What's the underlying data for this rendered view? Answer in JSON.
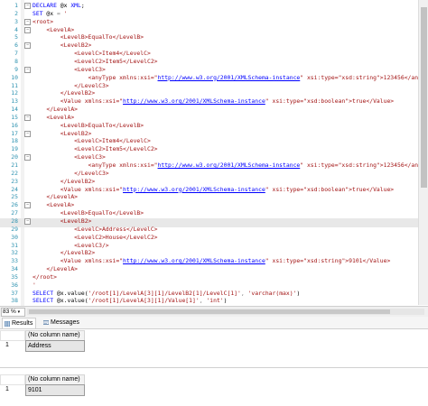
{
  "editor": {
    "lines": [
      {
        "n": "1",
        "c": [
          [
            "k",
            "DECLARE "
          ],
          [
            "p",
            "@x "
          ],
          [
            "k",
            "XML"
          ],
          [
            "p",
            ";"
          ]
        ]
      },
      {
        "n": "2",
        "c": [
          [
            "k",
            "SET "
          ],
          [
            "p",
            "@x "
          ],
          [
            "g",
            "= "
          ],
          [
            "str",
            "'"
          ]
        ]
      },
      {
        "n": "3",
        "c": [
          [
            "tag",
            "<root>"
          ]
        ]
      },
      {
        "n": "4",
        "c": [
          [
            "tag",
            "    <LevelA>"
          ]
        ]
      },
      {
        "n": "5",
        "c": [
          [
            "tag",
            "        <LevelB>EqualTo</LevelB>"
          ]
        ]
      },
      {
        "n": "6",
        "c": [
          [
            "tag",
            "        <LevelB2>"
          ]
        ]
      },
      {
        "n": "7",
        "c": [
          [
            "tag",
            "            <LevelC>Item4</LevelC>"
          ]
        ]
      },
      {
        "n": "8",
        "c": [
          [
            "tag",
            "            <LevelC2>Item5</LevelC2>"
          ]
        ]
      },
      {
        "n": "9",
        "c": [
          [
            "tag",
            "            <LevelC3>"
          ]
        ]
      },
      {
        "n": "10",
        "c": [
          [
            "tag",
            "                <anyType xmlns:xsi=\""
          ],
          [
            "url",
            "http://www.w3.org/2001/XMLSchema-instance"
          ],
          [
            "tag",
            "\" xsi:type=\"xsd:string\">123456</anyType>"
          ]
        ]
      },
      {
        "n": "11",
        "c": [
          [
            "tag",
            "            </LevelC3>"
          ]
        ]
      },
      {
        "n": "12",
        "c": [
          [
            "tag",
            "        </LevelB2>"
          ]
        ]
      },
      {
        "n": "13",
        "c": [
          [
            "tag",
            "        <Value xmlns:xsi=\""
          ],
          [
            "url",
            "http://www.w3.org/2001/XMLSchema-instance"
          ],
          [
            "tag",
            "\" xsi:type=\"xsd:boolean\">true</Value>"
          ]
        ]
      },
      {
        "n": "14",
        "c": [
          [
            "tag",
            "    </LevelA>"
          ]
        ]
      },
      {
        "n": "15",
        "c": [
          [
            "tag",
            "    <LevelA>"
          ]
        ]
      },
      {
        "n": "16",
        "c": [
          [
            "tag",
            "        <LevelB>EqualTo</LevelB>"
          ]
        ]
      },
      {
        "n": "17",
        "c": [
          [
            "tag",
            "        <LevelB2>"
          ]
        ]
      },
      {
        "n": "18",
        "c": [
          [
            "tag",
            "            <LevelC>Item4</LevelC>"
          ]
        ]
      },
      {
        "n": "19",
        "c": [
          [
            "tag",
            "            <LevelC2>Item5</LevelC2>"
          ]
        ]
      },
      {
        "n": "20",
        "c": [
          [
            "tag",
            "            <LevelC3>"
          ]
        ]
      },
      {
        "n": "21",
        "c": [
          [
            "tag",
            "                <anyType xmlns:xsi=\""
          ],
          [
            "url",
            "http://www.w3.org/2001/XMLSchema-instance"
          ],
          [
            "tag",
            "\" xsi:type=\"xsd:string\">123456</anyType>"
          ]
        ]
      },
      {
        "n": "22",
        "c": [
          [
            "tag",
            "            </LevelC3>"
          ]
        ]
      },
      {
        "n": "23",
        "c": [
          [
            "tag",
            "        </LevelB2>"
          ]
        ]
      },
      {
        "n": "24",
        "c": [
          [
            "tag",
            "        <Value xmlns:xsi=\""
          ],
          [
            "url",
            "http://www.w3.org/2001/XMLSchema-instance"
          ],
          [
            "tag",
            "\" xsi:type=\"xsd:boolean\">true</Value>"
          ]
        ]
      },
      {
        "n": "25",
        "c": [
          [
            "tag",
            "    </LevelA>"
          ]
        ]
      },
      {
        "n": "26",
        "c": [
          [
            "tag",
            "    <LevelA>"
          ]
        ]
      },
      {
        "n": "27",
        "c": [
          [
            "tag",
            "        <LevelB>EqualTo</LevelB>"
          ]
        ]
      },
      {
        "n": "28",
        "c": [
          [
            "tag",
            "        <LevelB2>"
          ]
        ]
      },
      {
        "n": "29",
        "c": [
          [
            "tag",
            "            <LevelC>Address</LevelC>"
          ]
        ]
      },
      {
        "n": "30",
        "c": [
          [
            "tag",
            "            <LevelC2>House</LevelC2>"
          ]
        ]
      },
      {
        "n": "31",
        "c": [
          [
            "tag",
            "            <LevelC3/>"
          ]
        ]
      },
      {
        "n": "32",
        "c": [
          [
            "tag",
            "        </LevelB2>"
          ]
        ]
      },
      {
        "n": "33",
        "c": [
          [
            "tag",
            "        <Value xmlns:xsi=\""
          ],
          [
            "url",
            "http://www.w3.org/2001/XMLSchema-instance"
          ],
          [
            "tag",
            "\" xsi:type=\"xsd:string\">9101</Value>"
          ]
        ]
      },
      {
        "n": "34",
        "c": [
          [
            "tag",
            "    </LevelA>"
          ]
        ]
      },
      {
        "n": "35",
        "c": [
          [
            "tag",
            "</root>"
          ]
        ]
      },
      {
        "n": "36",
        "c": [
          [
            "str",
            "'"
          ]
        ]
      },
      {
        "n": "37",
        "c": [
          [
            "k",
            "SELECT "
          ],
          [
            "p",
            "@x.value("
          ],
          [
            "str",
            "'/root[1]/LevelA[3][1]/LevelB2[1]/LevelC[1]'"
          ],
          [
            "g",
            ", "
          ],
          [
            "str",
            "'varchar(max)'"
          ],
          [
            "p",
            ")"
          ]
        ]
      },
      {
        "n": "38",
        "c": [
          [
            "k",
            "SELECT "
          ],
          [
            "p",
            "@x.value("
          ],
          [
            "str",
            "'/root[1]/LevelA[3][1]/Value[1]'"
          ],
          [
            "g",
            ", "
          ],
          [
            "str",
            "'int'"
          ],
          [
            "p",
            ")"
          ]
        ]
      }
    ]
  },
  "zoom": {
    "value": "83 %"
  },
  "tabs": {
    "results": "Results",
    "messages": "Messages"
  },
  "results": {
    "grid1": {
      "header": "(No column name)",
      "row_num": "1",
      "value": "Address"
    },
    "grid2": {
      "header": "(No column name)",
      "row_num": "1",
      "value": "9101"
    }
  }
}
